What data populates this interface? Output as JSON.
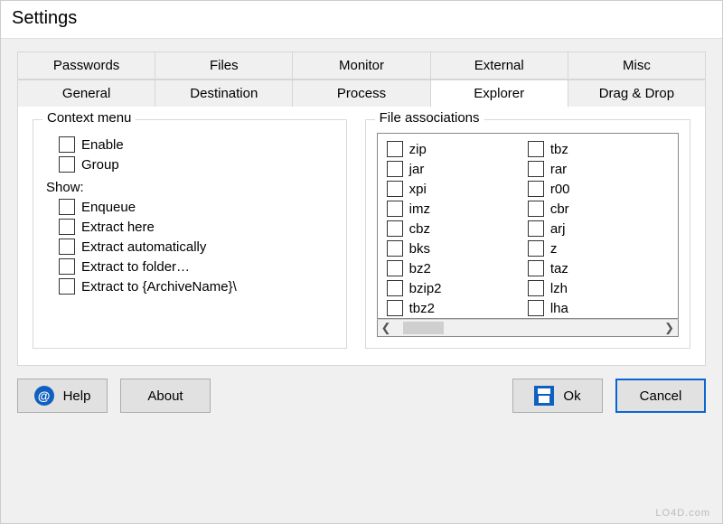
{
  "window": {
    "title": "Settings"
  },
  "tabs": {
    "row1": [
      "Passwords",
      "Files",
      "Monitor",
      "External",
      "Misc"
    ],
    "row2": [
      "General",
      "Destination",
      "Process",
      "Explorer",
      "Drag & Drop"
    ],
    "active": "Explorer"
  },
  "context_menu": {
    "legend": "Context menu",
    "enable": "Enable",
    "group": "Group",
    "show_label": "Show:",
    "items": [
      "Enqueue",
      "Extract here",
      "Extract automatically",
      "Extract to folder…",
      "Extract to {ArchiveName}\\"
    ]
  },
  "file_assoc": {
    "legend": "File associations",
    "col1": [
      "zip",
      "jar",
      "xpi",
      "imz",
      "cbz",
      "bks",
      "bz2",
      "bzip2",
      "tbz2"
    ],
    "col2": [
      "tbz",
      "rar",
      "r00",
      "cbr",
      "arj",
      "z",
      "taz",
      "lzh",
      "lha"
    ]
  },
  "buttons": {
    "help": "Help",
    "about": "About",
    "ok": "Ok",
    "cancel": "Cancel"
  },
  "watermark": "LO4D.com"
}
